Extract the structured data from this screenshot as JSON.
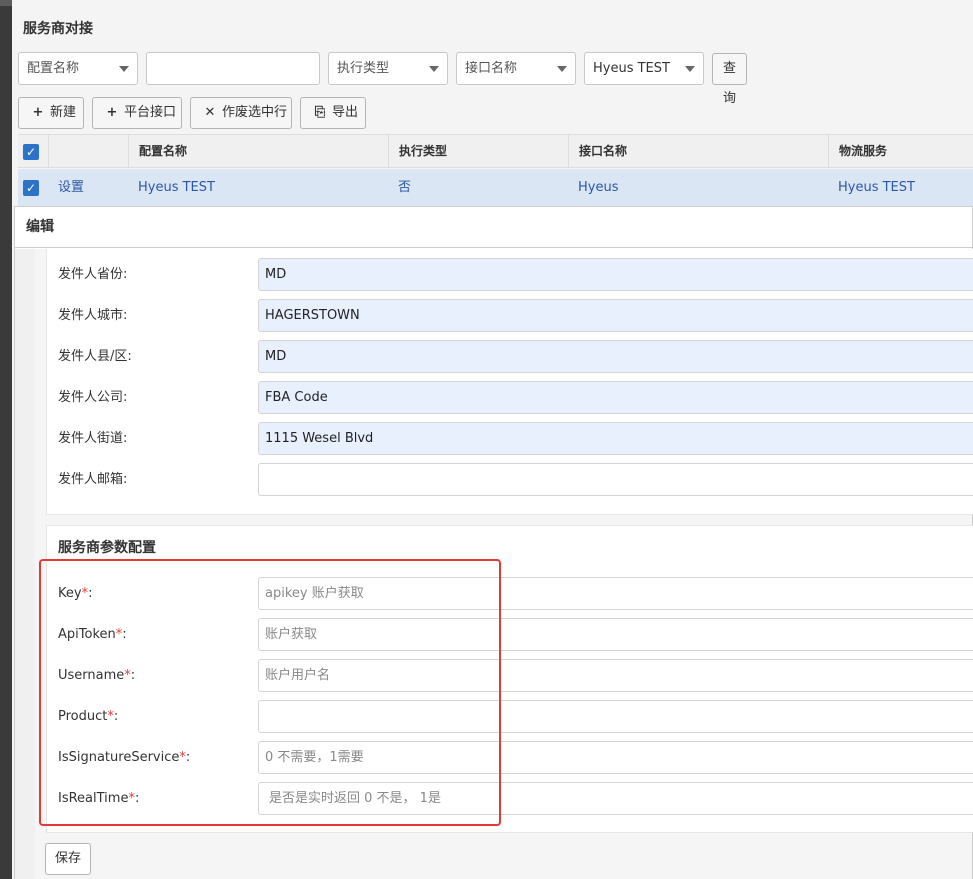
{
  "panel": {
    "title": "服务商对接"
  },
  "filters": {
    "config_name": "配置名称",
    "text_value": "",
    "exec_type": "执行类型",
    "api_name": "接口名称",
    "service": "Hyeus TEST",
    "query_label": "查询"
  },
  "toolbar": {
    "new_label": "新建",
    "platform_label": "平台接口",
    "void_label": "作废选中行",
    "export_label": "导出"
  },
  "grid": {
    "columns": [
      "配置名称",
      "执行类型",
      "接口名称",
      "物流服务"
    ],
    "row": {
      "action": "设置",
      "config_name": "Hyeus TEST",
      "exec_type": "否",
      "api_name": "Hyeus",
      "service": "Hyeus TEST"
    }
  },
  "dialog": {
    "title": "编辑",
    "sender": [
      {
        "label": "发件人省份:",
        "value": "MD"
      },
      {
        "label": "发件人城市:",
        "value": "HAGERSTOWN"
      },
      {
        "label": "发件人县/区:",
        "value": "MD"
      },
      {
        "label": "发件人公司:",
        "value": "FBA Code"
      },
      {
        "label": "发件人街道:",
        "value": "1115 Wesel Blvd"
      },
      {
        "label": "发件人邮箱:",
        "value": ""
      }
    ],
    "params_title": "服务商参数配置",
    "params": [
      {
        "label": "Key",
        "placeholder": "apikey 账户获取"
      },
      {
        "label": "ApiToken",
        "placeholder": "账户获取"
      },
      {
        "label": "Username",
        "placeholder": "账户用户名"
      },
      {
        "label": "Product",
        "placeholder": ""
      },
      {
        "label": "IsSignatureService",
        "placeholder": "0 不需要，1需要"
      },
      {
        "label": "IsRealTime",
        "placeholder": "是否是实时返回 0 不是， 1是"
      }
    ],
    "required_mark": "*",
    "colon": ":",
    "save_label": "保存"
  },
  "colors": {
    "highlight_box": "#e53935",
    "checkbox": "#2b72c8",
    "autofill": "#e8f0fe"
  }
}
